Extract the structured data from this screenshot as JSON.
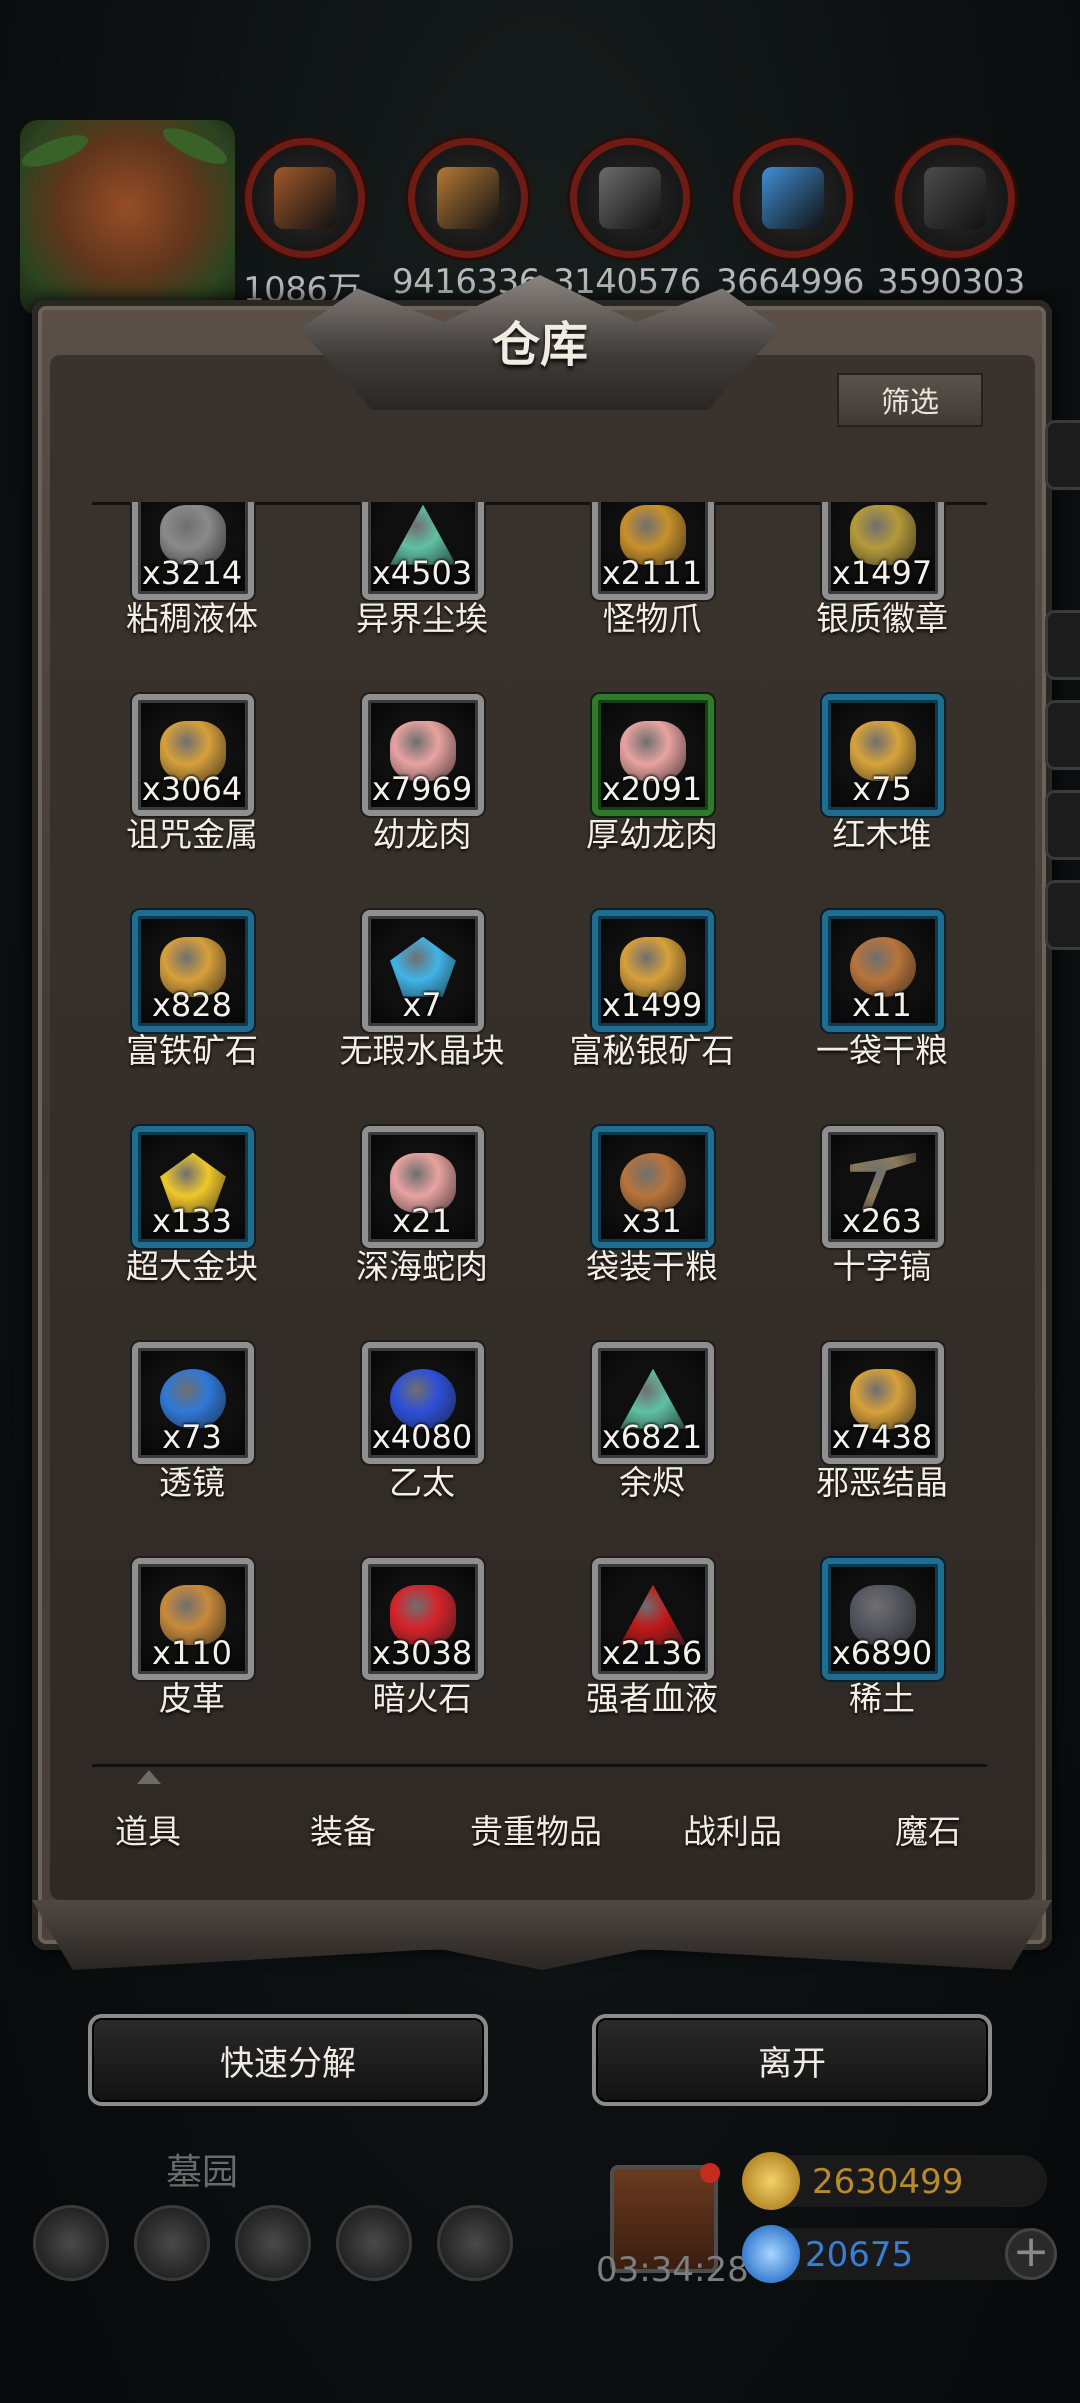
{
  "resources": [
    {
      "icon": "meat-icon",
      "value": "1086万",
      "color": "#a0582c"
    },
    {
      "icon": "wood-icon",
      "value": "9416336",
      "color": "#b57a36"
    },
    {
      "icon": "iron-ingot-icon",
      "value": "3140576",
      "color": "#6c6c6c"
    },
    {
      "icon": "crystal-icon",
      "value": "3664996",
      "color": "#3f8fd6"
    },
    {
      "icon": "stone-icon",
      "value": "3590303",
      "color": "#4c4c4c"
    }
  ],
  "panel": {
    "title": "仓库",
    "filter_label": "筛选"
  },
  "items": [
    {
      "name": "粘稠液体",
      "count": "x3214",
      "frame": "grey",
      "icon": "slime-icon",
      "color": "#8a8a8a"
    },
    {
      "name": "异界尘埃",
      "count": "x4503",
      "frame": "grey",
      "icon": "dust-icon",
      "color": "#5fc1a3"
    },
    {
      "name": "怪物爪",
      "count": "x2111",
      "frame": "grey",
      "icon": "claw-icon",
      "color": "#c8902a"
    },
    {
      "name": "银质徽章",
      "count": "x1497",
      "frame": "grey",
      "icon": "badge-icon",
      "color": "#b59a3a"
    },
    {
      "name": "诅咒金属",
      "count": "x3064",
      "frame": "grey",
      "icon": "ore-icon",
      "color": "#d7a03a"
    },
    {
      "name": "幼龙肉",
      "count": "x7969",
      "frame": "grey",
      "icon": "meat-slab-icon",
      "color": "#e8a3a0"
    },
    {
      "name": "厚幼龙肉",
      "count": "x2091",
      "frame": "green",
      "icon": "meat-slab-icon",
      "color": "#e8a3a0"
    },
    {
      "name": "红木堆",
      "count": "x75",
      "frame": "blue",
      "icon": "wood-pile-icon",
      "color": "#d9a33a"
    },
    {
      "name": "富铁矿石",
      "count": "x828",
      "frame": "blue",
      "icon": "ore-icon",
      "color": "#d7a03a"
    },
    {
      "name": "无瑕水晶块",
      "count": "x7",
      "frame": "grey",
      "icon": "crystal-chunk-icon",
      "color": "#3fb4e8"
    },
    {
      "name": "富秘银矿石",
      "count": "x1499",
      "frame": "blue",
      "icon": "ore-icon",
      "color": "#d7a03a"
    },
    {
      "name": "一袋干粮",
      "count": "x11",
      "frame": "blue",
      "icon": "ration-icon",
      "color": "#b8743a"
    },
    {
      "name": "超大金块",
      "count": "x133",
      "frame": "blue",
      "icon": "gold-nugget-icon",
      "color": "#f0c72a"
    },
    {
      "name": "深海蛇肉",
      "count": "x21",
      "frame": "grey",
      "icon": "meat-slab-icon",
      "color": "#e8a3a0"
    },
    {
      "name": "袋装干粮",
      "count": "x31",
      "frame": "blue",
      "icon": "ration-icon",
      "color": "#b8743a"
    },
    {
      "name": "十字镐",
      "count": "x263",
      "frame": "grey",
      "icon": "pickaxe-icon",
      "color": "#8a7a5a"
    },
    {
      "name": "透镜",
      "count": "x73",
      "frame": "grey",
      "icon": "lens-icon",
      "color": "#2f78d8"
    },
    {
      "name": "乙太",
      "count": "x4080",
      "frame": "grey",
      "icon": "ether-orb-icon",
      "color": "#2d4fd9"
    },
    {
      "name": "余烬",
      "count": "x6821",
      "frame": "grey",
      "icon": "dust-icon",
      "color": "#5fc1a3"
    },
    {
      "name": "邪恶结晶",
      "count": "x7438",
      "frame": "grey",
      "icon": "ore-icon",
      "color": "#d7a03a"
    },
    {
      "name": "皮革",
      "count": "x110",
      "frame": "grey",
      "icon": "leather-icon",
      "color": "#c98a3a"
    },
    {
      "name": "暗火石",
      "count": "x3038",
      "frame": "grey",
      "icon": "fire-stone-icon",
      "color": "#d6232a"
    },
    {
      "name": "强者血液",
      "count": "x2136",
      "frame": "grey",
      "icon": "blood-drop-icon",
      "color": "#c01818"
    },
    {
      "name": "稀土",
      "count": "x6890",
      "frame": "blue",
      "icon": "rare-earth-icon",
      "color": "#55555f"
    }
  ],
  "tabs": [
    "道具",
    "装备",
    "贵重物品",
    "战利品",
    "魔石"
  ],
  "active_tab": "道具",
  "actions": {
    "decompose_label": "快速分解",
    "leave_label": "离开"
  },
  "hud": {
    "location": "墓园",
    "timer": "03:34:28",
    "gold": "2630499",
    "gems": "20675",
    "gold_color": "#b88a2a",
    "gem_color": "#3a7ed1"
  }
}
